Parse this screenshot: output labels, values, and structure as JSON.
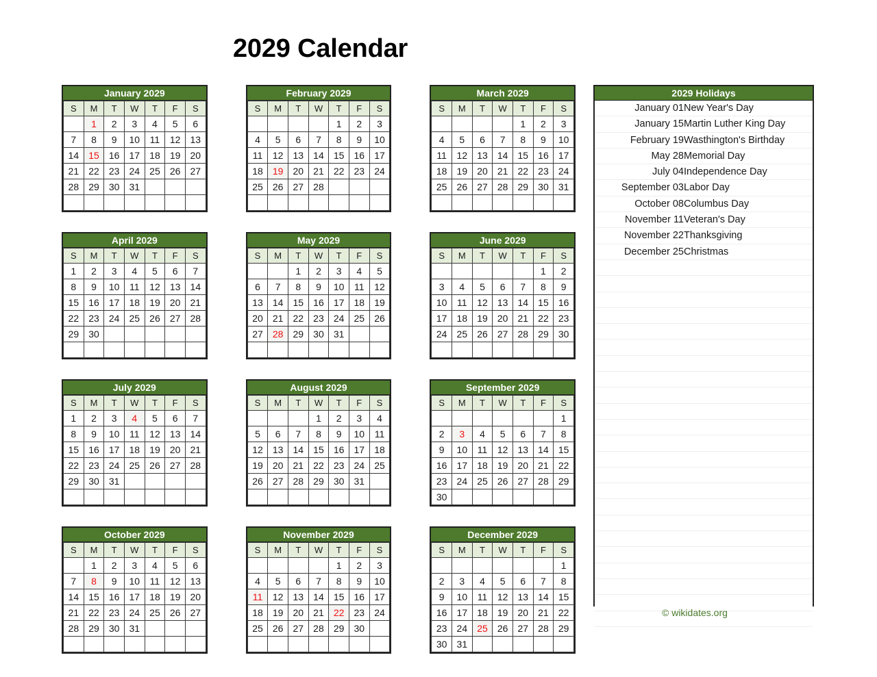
{
  "page": {
    "title": "2029 Calendar",
    "footer": "© wikidates.org",
    "accent_color": "#4d7a2c",
    "holiday_color": "#ee1111",
    "weekday_header_bg": "#e4edda"
  },
  "weekdays": [
    "S",
    "M",
    "T",
    "W",
    "T",
    "F",
    "S"
  ],
  "months": [
    {
      "name": "January 2029",
      "weeks": [
        [
          "",
          "1",
          "2",
          "3",
          "4",
          "5",
          "6"
        ],
        [
          "7",
          "8",
          "9",
          "10",
          "11",
          "12",
          "13"
        ],
        [
          "14",
          "15",
          "16",
          "17",
          "18",
          "19",
          "20"
        ],
        [
          "21",
          "22",
          "23",
          "24",
          "25",
          "26",
          "27"
        ],
        [
          "28",
          "29",
          "30",
          "31",
          "",
          "",
          ""
        ],
        [
          "",
          "",
          "",
          "",
          "",
          "",
          ""
        ]
      ],
      "holidays": [
        "1",
        "15"
      ]
    },
    {
      "name": "February 2029",
      "weeks": [
        [
          "",
          "",
          "",
          "",
          "1",
          "2",
          "3"
        ],
        [
          "4",
          "5",
          "6",
          "7",
          "8",
          "9",
          "10"
        ],
        [
          "11",
          "12",
          "13",
          "14",
          "15",
          "16",
          "17"
        ],
        [
          "18",
          "19",
          "20",
          "21",
          "22",
          "23",
          "24"
        ],
        [
          "25",
          "26",
          "27",
          "28",
          "",
          "",
          ""
        ],
        [
          "",
          "",
          "",
          "",
          "",
          "",
          ""
        ]
      ],
      "holidays": [
        "19"
      ]
    },
    {
      "name": "March 2029",
      "weeks": [
        [
          "",
          "",
          "",
          "",
          "1",
          "2",
          "3"
        ],
        [
          "4",
          "5",
          "6",
          "7",
          "8",
          "9",
          "10"
        ],
        [
          "11",
          "12",
          "13",
          "14",
          "15",
          "16",
          "17"
        ],
        [
          "18",
          "19",
          "20",
          "21",
          "22",
          "23",
          "24"
        ],
        [
          "25",
          "26",
          "27",
          "28",
          "29",
          "30",
          "31"
        ],
        [
          "",
          "",
          "",
          "",
          "",
          "",
          ""
        ]
      ],
      "holidays": []
    },
    {
      "name": "April 2029",
      "weeks": [
        [
          "1",
          "2",
          "3",
          "4",
          "5",
          "6",
          "7"
        ],
        [
          "8",
          "9",
          "10",
          "11",
          "12",
          "13",
          "14"
        ],
        [
          "15",
          "16",
          "17",
          "18",
          "19",
          "20",
          "21"
        ],
        [
          "22",
          "23",
          "24",
          "25",
          "26",
          "27",
          "28"
        ],
        [
          "29",
          "30",
          "",
          "",
          "",
          "",
          ""
        ],
        [
          "",
          "",
          "",
          "",
          "",
          "",
          ""
        ]
      ],
      "holidays": []
    },
    {
      "name": "May 2029",
      "weeks": [
        [
          "",
          "",
          "1",
          "2",
          "3",
          "4",
          "5"
        ],
        [
          "6",
          "7",
          "8",
          "9",
          "10",
          "11",
          "12"
        ],
        [
          "13",
          "14",
          "15",
          "16",
          "17",
          "18",
          "19"
        ],
        [
          "20",
          "21",
          "22",
          "23",
          "24",
          "25",
          "26"
        ],
        [
          "27",
          "28",
          "29",
          "30",
          "31",
          "",
          ""
        ],
        [
          "",
          "",
          "",
          "",
          "",
          "",
          ""
        ]
      ],
      "holidays": [
        "28"
      ]
    },
    {
      "name": "June 2029",
      "weeks": [
        [
          "",
          "",
          "",
          "",
          "",
          "1",
          "2"
        ],
        [
          "3",
          "4",
          "5",
          "6",
          "7",
          "8",
          "9"
        ],
        [
          "10",
          "11",
          "12",
          "13",
          "14",
          "15",
          "16"
        ],
        [
          "17",
          "18",
          "19",
          "20",
          "21",
          "22",
          "23"
        ],
        [
          "24",
          "25",
          "26",
          "27",
          "28",
          "29",
          "30"
        ],
        [
          "",
          "",
          "",
          "",
          "",
          "",
          ""
        ]
      ],
      "holidays": []
    },
    {
      "name": "July 2029",
      "weeks": [
        [
          "1",
          "2",
          "3",
          "4",
          "5",
          "6",
          "7"
        ],
        [
          "8",
          "9",
          "10",
          "11",
          "12",
          "13",
          "14"
        ],
        [
          "15",
          "16",
          "17",
          "18",
          "19",
          "20",
          "21"
        ],
        [
          "22",
          "23",
          "24",
          "25",
          "26",
          "27",
          "28"
        ],
        [
          "29",
          "30",
          "31",
          "",
          "",
          "",
          ""
        ],
        [
          "",
          "",
          "",
          "",
          "",
          "",
          ""
        ]
      ],
      "holidays": [
        "4"
      ]
    },
    {
      "name": "August 2029",
      "weeks": [
        [
          "",
          "",
          "",
          "1",
          "2",
          "3",
          "4"
        ],
        [
          "5",
          "6",
          "7",
          "8",
          "9",
          "10",
          "11"
        ],
        [
          "12",
          "13",
          "14",
          "15",
          "16",
          "17",
          "18"
        ],
        [
          "19",
          "20",
          "21",
          "22",
          "23",
          "24",
          "25"
        ],
        [
          "26",
          "27",
          "28",
          "29",
          "30",
          "31",
          ""
        ],
        [
          "",
          "",
          "",
          "",
          "",
          "",
          ""
        ]
      ],
      "holidays": []
    },
    {
      "name": "September 2029",
      "weeks": [
        [
          "",
          "",
          "",
          "",
          "",
          "",
          "1"
        ],
        [
          "2",
          "3",
          "4",
          "5",
          "6",
          "7",
          "8"
        ],
        [
          "9",
          "10",
          "11",
          "12",
          "13",
          "14",
          "15"
        ],
        [
          "16",
          "17",
          "18",
          "19",
          "20",
          "21",
          "22"
        ],
        [
          "23",
          "24",
          "25",
          "26",
          "27",
          "28",
          "29"
        ],
        [
          "30",
          "",
          "",
          "",
          "",
          "",
          ""
        ]
      ],
      "holidays": [
        "3"
      ]
    },
    {
      "name": "October 2029",
      "weeks": [
        [
          "",
          "1",
          "2",
          "3",
          "4",
          "5",
          "6"
        ],
        [
          "7",
          "8",
          "9",
          "10",
          "11",
          "12",
          "13"
        ],
        [
          "14",
          "15",
          "16",
          "17",
          "18",
          "19",
          "20"
        ],
        [
          "21",
          "22",
          "23",
          "24",
          "25",
          "26",
          "27"
        ],
        [
          "28",
          "29",
          "30",
          "31",
          "",
          "",
          ""
        ],
        [
          "",
          "",
          "",
          "",
          "",
          "",
          ""
        ]
      ],
      "holidays": [
        "8"
      ]
    },
    {
      "name": "November 2029",
      "weeks": [
        [
          "",
          "",
          "",
          "",
          "1",
          "2",
          "3"
        ],
        [
          "4",
          "5",
          "6",
          "7",
          "8",
          "9",
          "10"
        ],
        [
          "11",
          "12",
          "13",
          "14",
          "15",
          "16",
          "17"
        ],
        [
          "18",
          "19",
          "20",
          "21",
          "22",
          "23",
          "24"
        ],
        [
          "25",
          "26",
          "27",
          "28",
          "29",
          "30",
          ""
        ],
        [
          "",
          "",
          "",
          "",
          "",
          "",
          ""
        ]
      ],
      "holidays": [
        "11",
        "22"
      ]
    },
    {
      "name": "December 2029",
      "weeks": [
        [
          "",
          "",
          "",
          "",
          "",
          "",
          "1"
        ],
        [
          "2",
          "3",
          "4",
          "5",
          "6",
          "7",
          "8"
        ],
        [
          "9",
          "10",
          "11",
          "12",
          "13",
          "14",
          "15"
        ],
        [
          "16",
          "17",
          "18",
          "19",
          "20",
          "21",
          "22"
        ],
        [
          "23",
          "24",
          "25",
          "26",
          "27",
          "28",
          "29"
        ],
        [
          "30",
          "31",
          "",
          "",
          "",
          "",
          ""
        ]
      ],
      "holidays": [
        "25"
      ]
    }
  ],
  "holidays_panel": {
    "title": "2029 Holidays",
    "total_rows": 33,
    "items": [
      {
        "date": "January 01",
        "name": "New Year's Day"
      },
      {
        "date": "January 15",
        "name": "Martin Luther King Day"
      },
      {
        "date": "February 19",
        "name": "Wasthington's Birthday"
      },
      {
        "date": "May 28",
        "name": "Memorial Day"
      },
      {
        "date": "July 04",
        "name": "Independence Day"
      },
      {
        "date": "September 03",
        "name": "Labor Day"
      },
      {
        "date": "October 08",
        "name": "Columbus Day"
      },
      {
        "date": "November 11",
        "name": "Veteran's Day"
      },
      {
        "date": "November 22",
        "name": "Thanksgiving"
      },
      {
        "date": "December 25",
        "name": "Christmas"
      }
    ]
  }
}
